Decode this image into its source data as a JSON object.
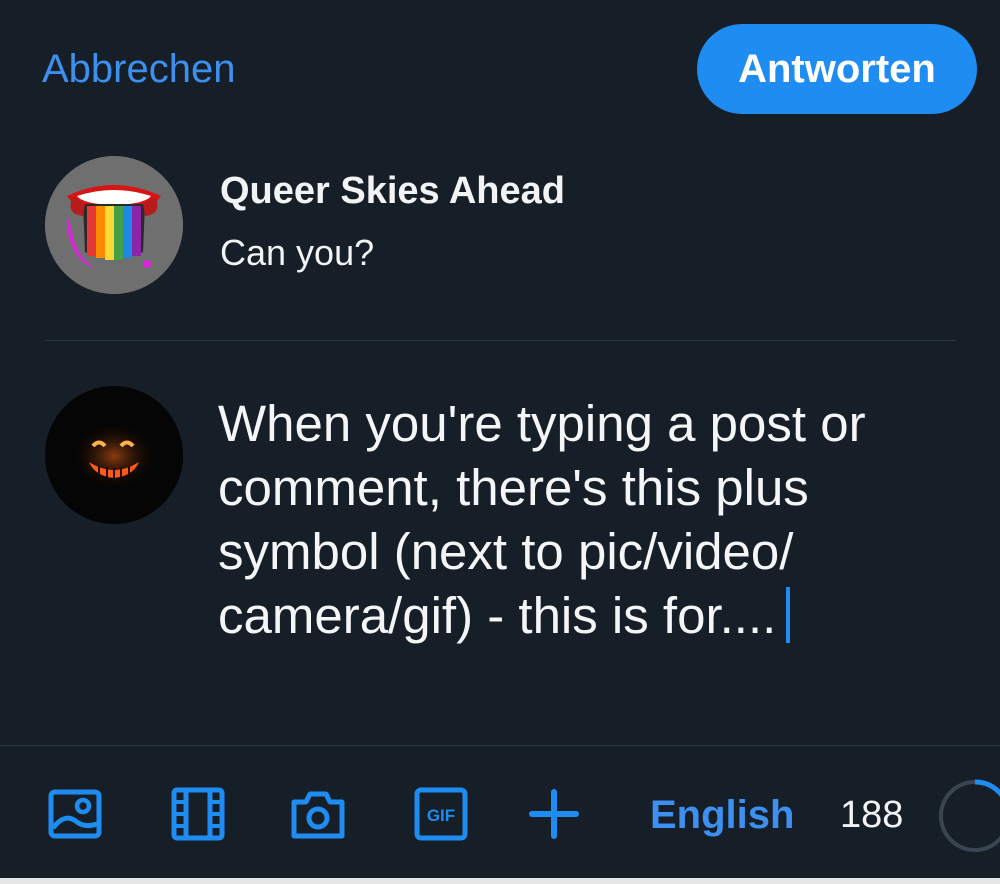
{
  "header": {
    "cancel_label": "Abbrechen",
    "reply_label": "Antworten"
  },
  "parent_post": {
    "author": "Queer Skies Ahead",
    "text": "Can you?"
  },
  "compose": {
    "text": "When you're typing a post or\ncomment, there's this plus\nsymbol (next to pic/video/\ncamera/gif) - this is for...."
  },
  "toolbar": {
    "icons": [
      "image-icon",
      "video-icon",
      "camera-icon",
      "gif-icon",
      "plus-icon"
    ],
    "language": "English",
    "char_remaining": "188"
  },
  "colors": {
    "background": "#161e27",
    "accent": "#1e8cf0",
    "link": "#3d8ff0",
    "divider": "#2c3744"
  }
}
